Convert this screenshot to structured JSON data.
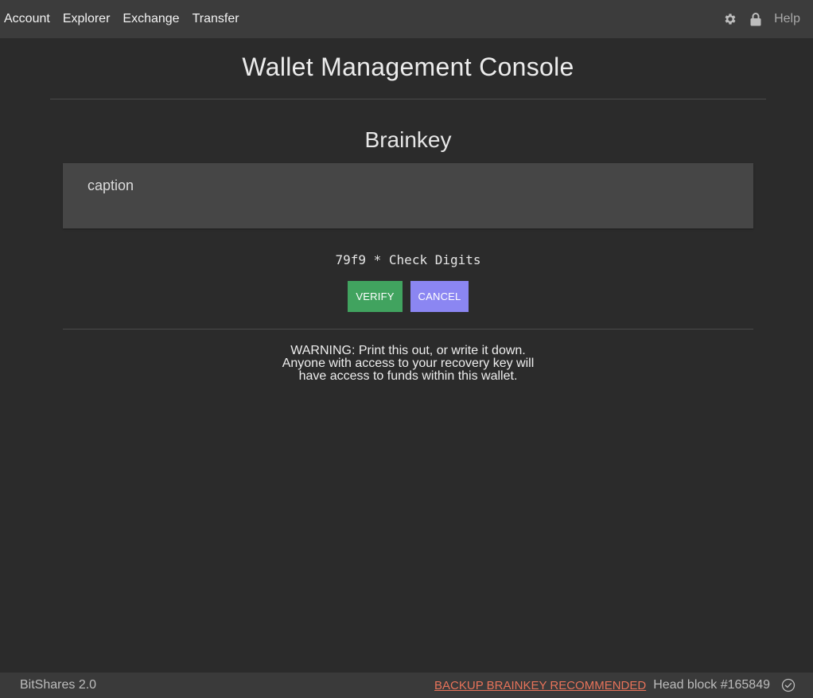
{
  "nav": {
    "items": [
      {
        "label": "Account"
      },
      {
        "label": "Explorer"
      },
      {
        "label": "Exchange"
      },
      {
        "label": "Transfer"
      }
    ],
    "icons": [
      "gear-icon",
      "lock-icon"
    ],
    "help_label": "Help"
  },
  "page": {
    "title": "Wallet Management Console"
  },
  "brainkey": {
    "title": "Brainkey",
    "text": "caption",
    "check_digits": "79f9 * Check Digits",
    "verify_label": "VERIFY",
    "cancel_label": "CANCEL",
    "warning_lines": [
      "WARNING: Print this out, or write it down.",
      "Anyone with access to your recovery key will",
      "have access to funds within this wallet."
    ]
  },
  "footer": {
    "brand": "BitShares 2.0",
    "backup_warning": "BACKUP BRAINKEY RECOMMENDED",
    "head_block": "Head block #165849",
    "status_icon": "check-circle-icon"
  },
  "colors": {
    "background": "#2b2b2b",
    "topbar": "#3c3c3c",
    "verify": "#41a35f",
    "cancel": "#8b86f2",
    "footer_warning": "#e8735a"
  }
}
